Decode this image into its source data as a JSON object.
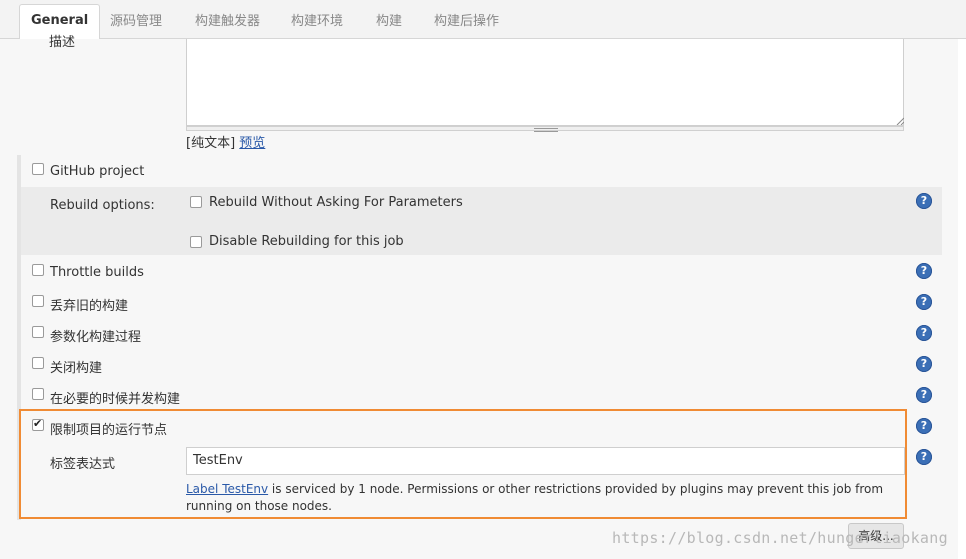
{
  "tabs": [
    "General",
    "源码管理",
    "构建触发器",
    "构建环境",
    "构建",
    "构建后操作"
  ],
  "description": {
    "label": "描述",
    "value": "",
    "plain_text": "[纯文本]",
    "preview_link": "预览"
  },
  "options": {
    "github_project": "GitHub project",
    "rebuild_options_label": "Rebuild options:",
    "rebuild_without_asking": "Rebuild Without Asking For Parameters",
    "disable_rebuilding": "Disable Rebuilding for this job",
    "throttle_builds": "Throttle builds",
    "discard_old_builds": "丢弃旧的构建",
    "parameterized": "参数化构建过程",
    "disable_build": "关闭构建",
    "concurrent_builds": "在必要的时候并发构建",
    "restrict_node": "限制项目的运行节点"
  },
  "checked": {
    "github_project": false,
    "rebuild_without_asking": false,
    "disable_rebuilding": false,
    "throttle_builds": false,
    "discard_old_builds": false,
    "parameterized": false,
    "disable_build": false,
    "concurrent_builds": false,
    "restrict_node": true
  },
  "label_expression": {
    "label": "标签表达式",
    "value": "TestEnv",
    "status_link": "Label TestEnv",
    "status_text": " is serviced by 1 node. Permissions or other restrictions provided by plugins may prevent this job from running on those nodes."
  },
  "advanced_button": "高级...",
  "help_icon_glyph": "?",
  "watermark": "https://blog.csdn.net/hungerliaokang",
  "colors": {
    "highlight_border": "#f08b34",
    "help_icon": "#3b6fb6",
    "link": "#2a59a8"
  }
}
